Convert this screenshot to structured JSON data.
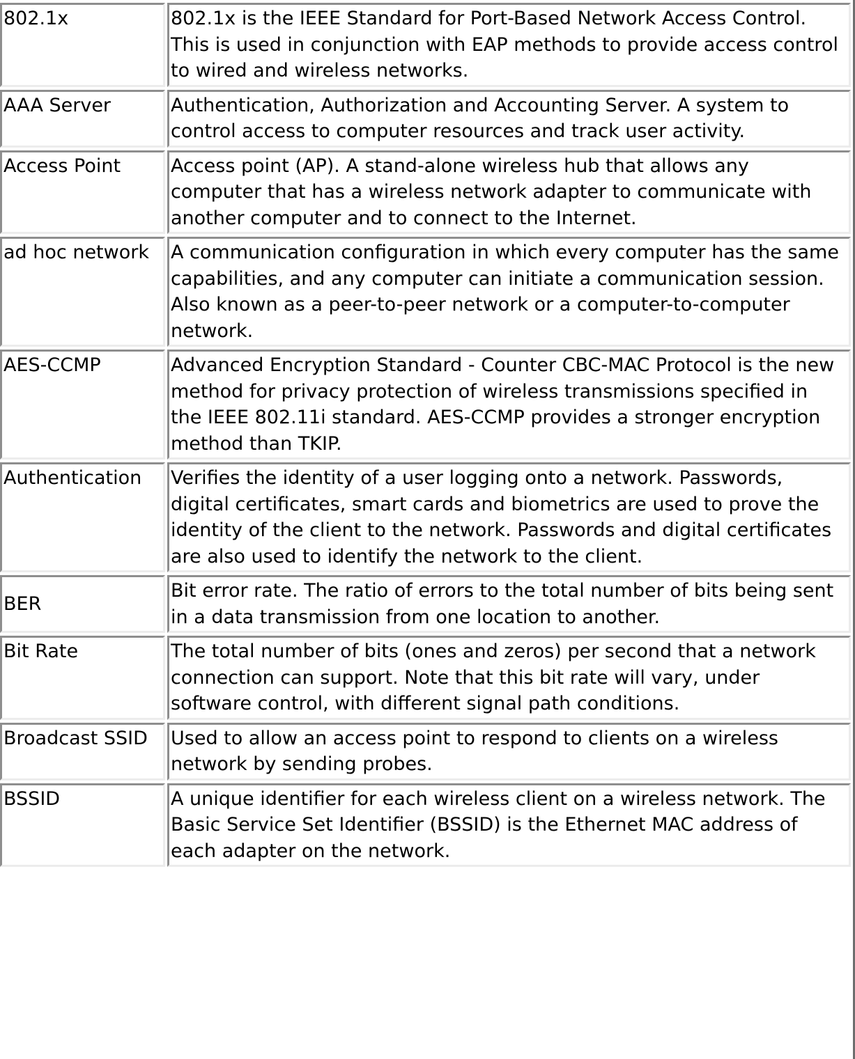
{
  "glossary": {
    "rows": [
      {
        "term": "802.1x",
        "definition": "802.1x is the IEEE Standard for Port-Based Network Access Control. This is used in conjunction with EAP methods to provide access control to wired and wireless networks."
      },
      {
        "term": "AAA Server",
        "definition": "Authentication, Authorization and Accounting Server. A system to control access to computer resources and track user activity."
      },
      {
        "term": "Access Point",
        "definition": "Access point (AP). A stand-alone wireless hub that allows any computer that has a wireless network adapter to communicate with another computer and to connect to the Internet."
      },
      {
        "term": "ad hoc network",
        "definition": "A communication configuration in which every computer has the same capabilities, and any computer can initiate a communication session. Also known as a peer-to-peer network or a computer-to-computer network."
      },
      {
        "term": "AES-CCMP",
        "definition": "Advanced Encryption Standard - Counter CBC-MAC Protocol is the new method for privacy protection of wireless transmissions specified in the IEEE 802.11i standard. AES-CCMP provides a stronger encryption method than TKIP."
      },
      {
        "term": "Authentication",
        "definition": "Verifies the identity of a user logging onto a network. Passwords, digital certificates, smart cards and biometrics are used to prove the identity of the client to the network. Passwords and digital certificates are also used to identify the network to the client."
      },
      {
        "term": "BER",
        "definition": "Bit error rate. The ratio of errors to the total number of bits being sent in a data transmission from one location to another."
      },
      {
        "term": "Bit Rate",
        "definition": "The total number of bits (ones and zeros) per second that a network connection can support. Note that this bit rate will vary, under software control, with different signal path conditions."
      },
      {
        "term": "Broadcast SSID",
        "definition": "Used to allow an access point to respond to clients on a wireless network by sending probes."
      },
      {
        "term": "BSSID",
        "definition": "A unique identifier for each wireless client on a wireless network. The Basic Service Set Identifier (BSSID) is the Ethernet MAC address of each adapter on the network."
      }
    ]
  }
}
